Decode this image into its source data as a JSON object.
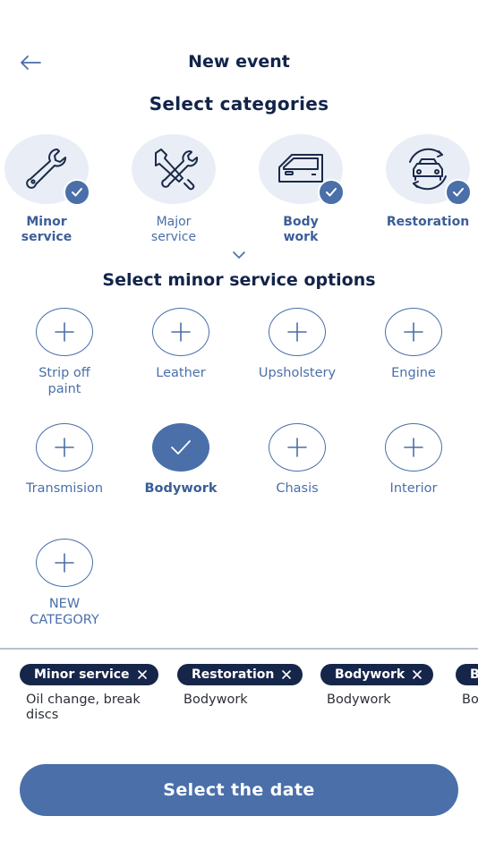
{
  "header": {
    "title": "New event"
  },
  "categories": {
    "title": "Select categories",
    "items": [
      {
        "line1": "Minor",
        "line2": "service",
        "icon": "wrench-icon",
        "selected": true
      },
      {
        "line1": "Major",
        "line2": "service",
        "icon": "tools-icon",
        "selected": false
      },
      {
        "line1": "Body",
        "line2": "work",
        "icon": "car-door-icon",
        "selected": true
      },
      {
        "line1": "Restoration",
        "line2": "",
        "icon": "car-restore-icon",
        "selected": true
      }
    ]
  },
  "options": {
    "title": "Select minor service options",
    "items": [
      {
        "line1": "Strip off",
        "line2": "paint",
        "selected": false
      },
      {
        "line1": "Leather",
        "line2": "",
        "selected": false
      },
      {
        "line1": "Upsholstery",
        "line2": "",
        "selected": false
      },
      {
        "line1": "Engine",
        "line2": "",
        "selected": false
      },
      {
        "line1": "Transmision",
        "line2": "",
        "selected": false
      },
      {
        "line1": "Bodywork",
        "line2": "",
        "selected": true
      },
      {
        "line1": "Chasis",
        "line2": "",
        "selected": false
      },
      {
        "line1": "Interior",
        "line2": "",
        "selected": false
      },
      {
        "line1": "NEW",
        "line2": "CATEGORY",
        "selected": false
      }
    ]
  },
  "chips": [
    {
      "label": "Minor service",
      "desc": "Oil change, break discs"
    },
    {
      "label": "Restoration",
      "desc": "Bodywork"
    },
    {
      "label": "Bodywork",
      "desc": "Bodywork"
    },
    {
      "label": "B",
      "desc": "Bo"
    }
  ],
  "cta": {
    "label": "Select the date"
  },
  "colors": {
    "accent": "#4a6fa9",
    "navy": "#16264a",
    "circle_bg": "#e9eef6"
  }
}
